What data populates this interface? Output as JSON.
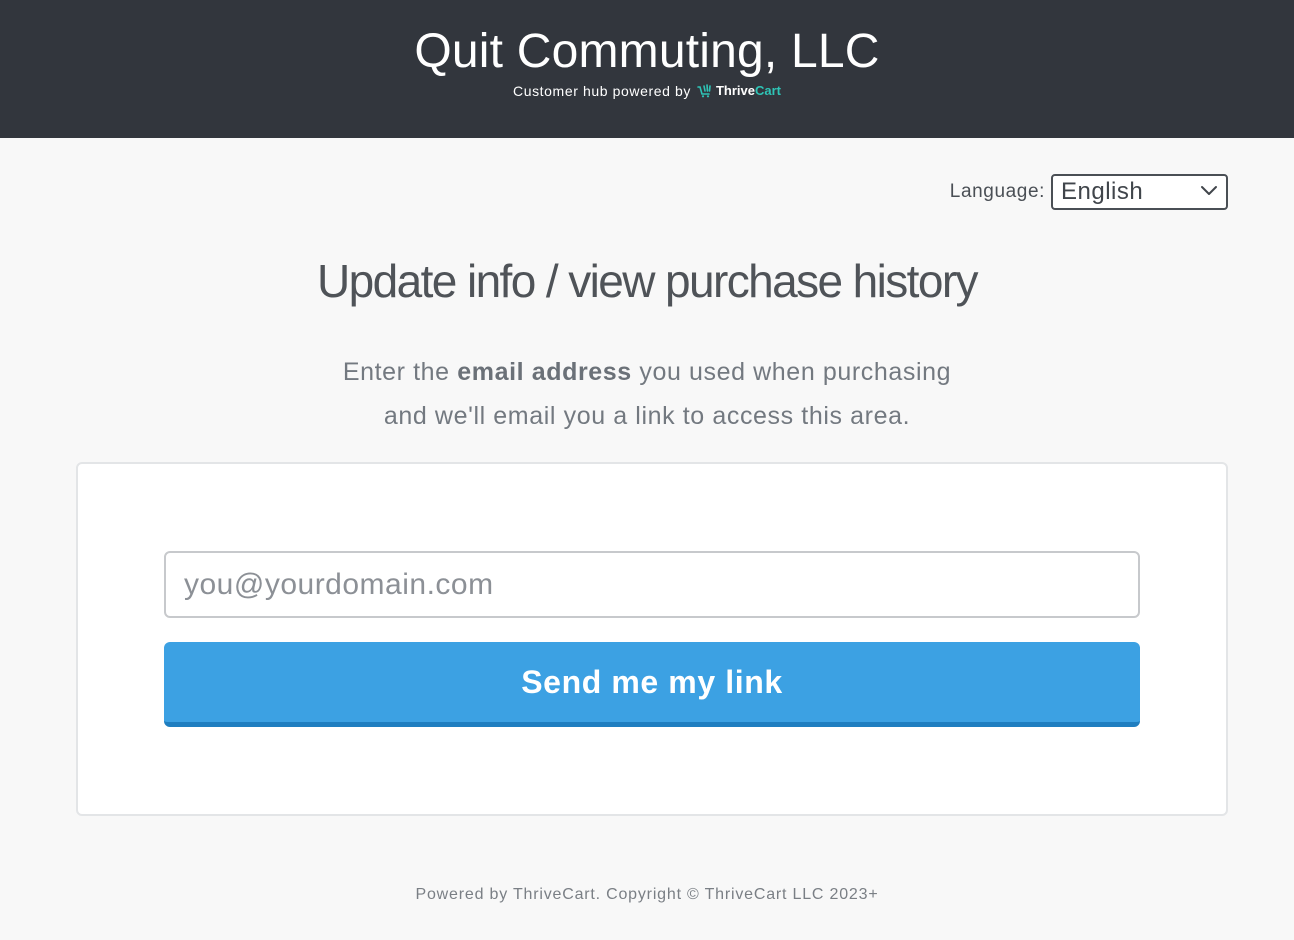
{
  "header": {
    "store_name": "Quit Commuting, LLC",
    "hub_text": "Customer hub powered by",
    "brand_name_part1": "Thrive",
    "brand_name_part2": "Cart",
    "background_color": "#32363d",
    "brand_accent_color": "#2ec4b6",
    "brand_icon": "shopping-cart-icon"
  },
  "language": {
    "label": "Language:",
    "selected": "English",
    "icon": "chevron-down-icon"
  },
  "main": {
    "heading": "Update info / view purchase history",
    "intro_before_bold": "Enter the",
    "intro_bold": "email address",
    "intro_after_bold": "you used when purchasing",
    "intro_line2": "and we'll email you a link to access this area."
  },
  "form": {
    "email_placeholder": "you@yourdomain.com",
    "email_value": "",
    "submit_label": "Send me my link",
    "button_color": "#3ca1e3"
  },
  "footer": {
    "text": "Powered by ThriveCart. Copyright © ThriveCart LLC 2023+"
  }
}
